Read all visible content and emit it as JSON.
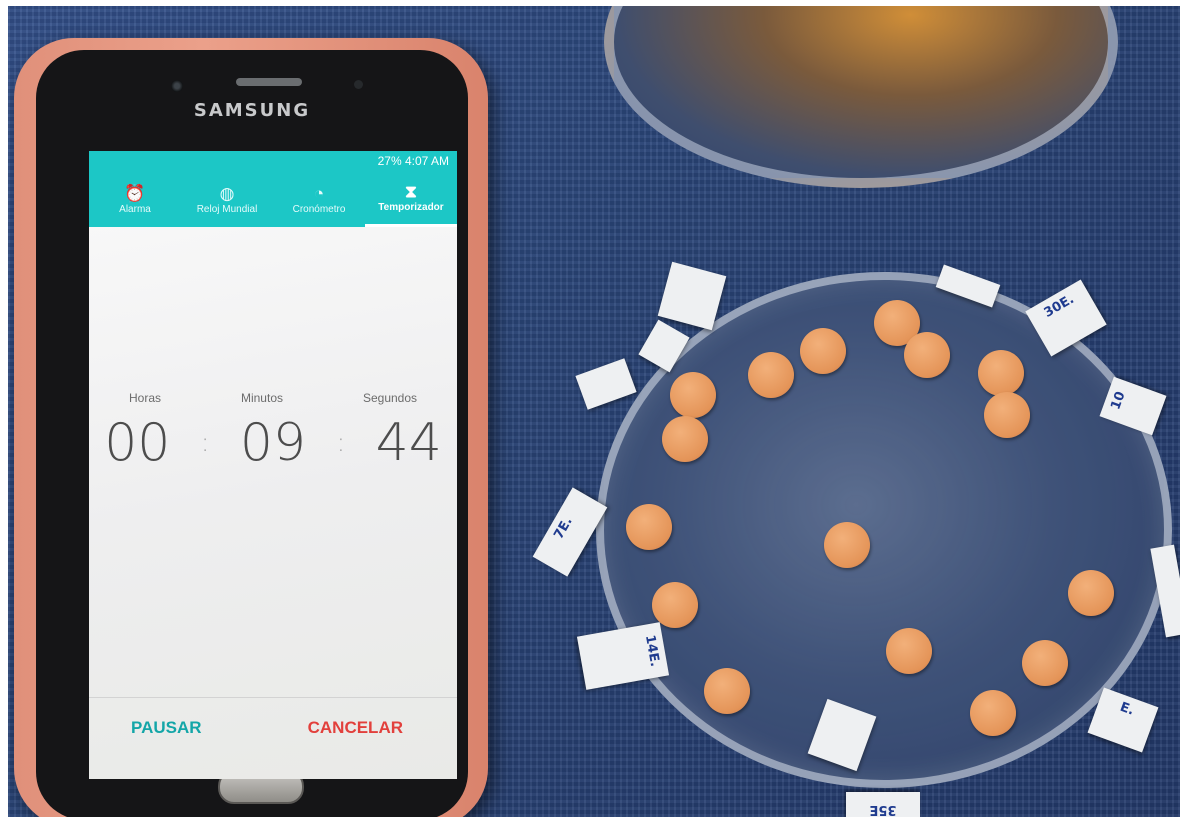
{
  "phone": {
    "brand": "SAMSUNG",
    "status_bar": "27% 4:07 AM",
    "tabs": [
      {
        "label": "Alarma",
        "icon": "alarm-icon"
      },
      {
        "label": "Reloj Mundial",
        "icon": "world-clock-icon"
      },
      {
        "label": "Cronómetro",
        "icon": "stopwatch-icon"
      },
      {
        "label": "Temporizador",
        "icon": "hourglass-icon",
        "active": true
      }
    ],
    "timer": {
      "labels": {
        "hours": "Horas",
        "minutes": "Minutos",
        "seconds": "Segundos"
      },
      "hours": "00",
      "minutes": "09",
      "seconds": "44",
      "separator": ":"
    },
    "buttons": {
      "pause": "PAUSAR",
      "cancel": "CANCELAR"
    }
  },
  "dish_labels": [
    "7E.",
    "14E.",
    "30E.",
    "10",
    "35E",
    "E."
  ],
  "colors": {
    "accent": "#1cc7c6",
    "pause": "#14a6a8",
    "cancel": "#e2403c",
    "disc": "#e49458",
    "cloth": "#2a4578",
    "case": "#eba08a"
  }
}
